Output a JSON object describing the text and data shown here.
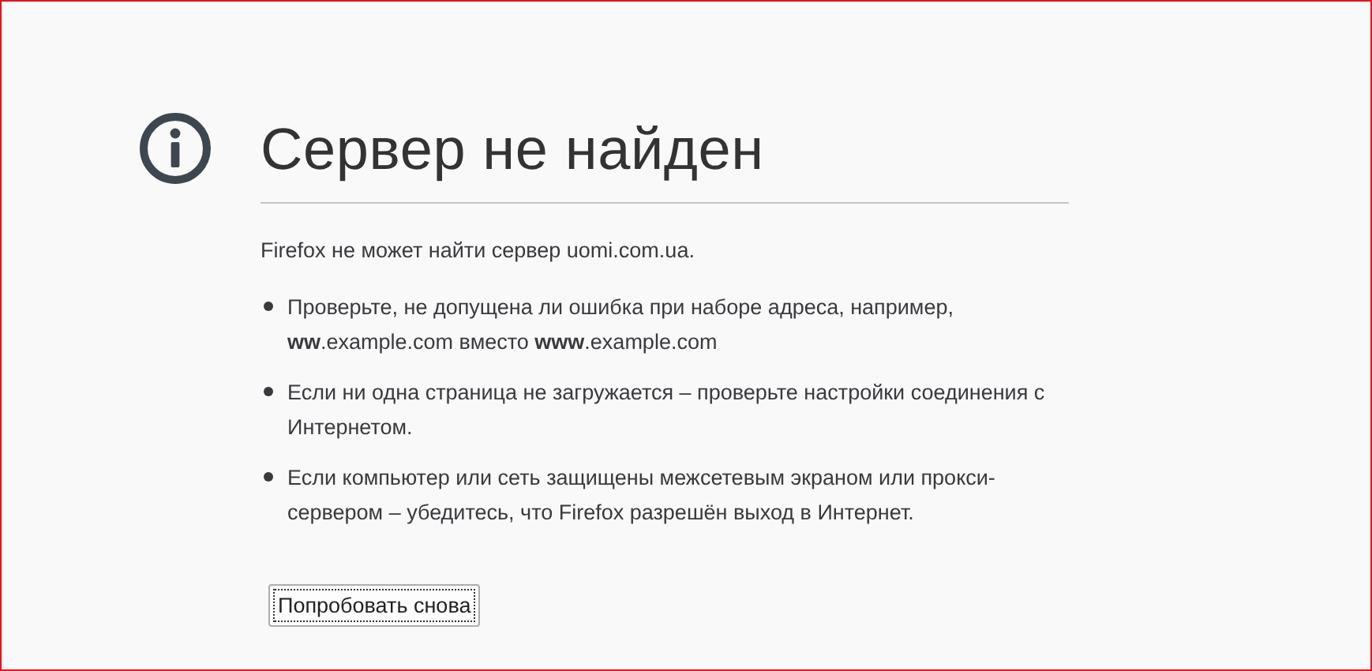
{
  "title": "Сервер не найден",
  "message": "Firefox не может найти сервер uomi.com.ua.",
  "tips": [
    "Проверьте, не допущена ли ошибка при наборе адреса, например, **ww**.example.com вместо **www**.example.com",
    "Если ни одна страница не загружается – проверьте настройки соединения с Интернетом.",
    "Если компьютер или сеть защищены межсетевым экраном или прокси-сервером – убедитесь, что Firefox разрешён выход в Интернет."
  ],
  "button": "Попробовать снова"
}
